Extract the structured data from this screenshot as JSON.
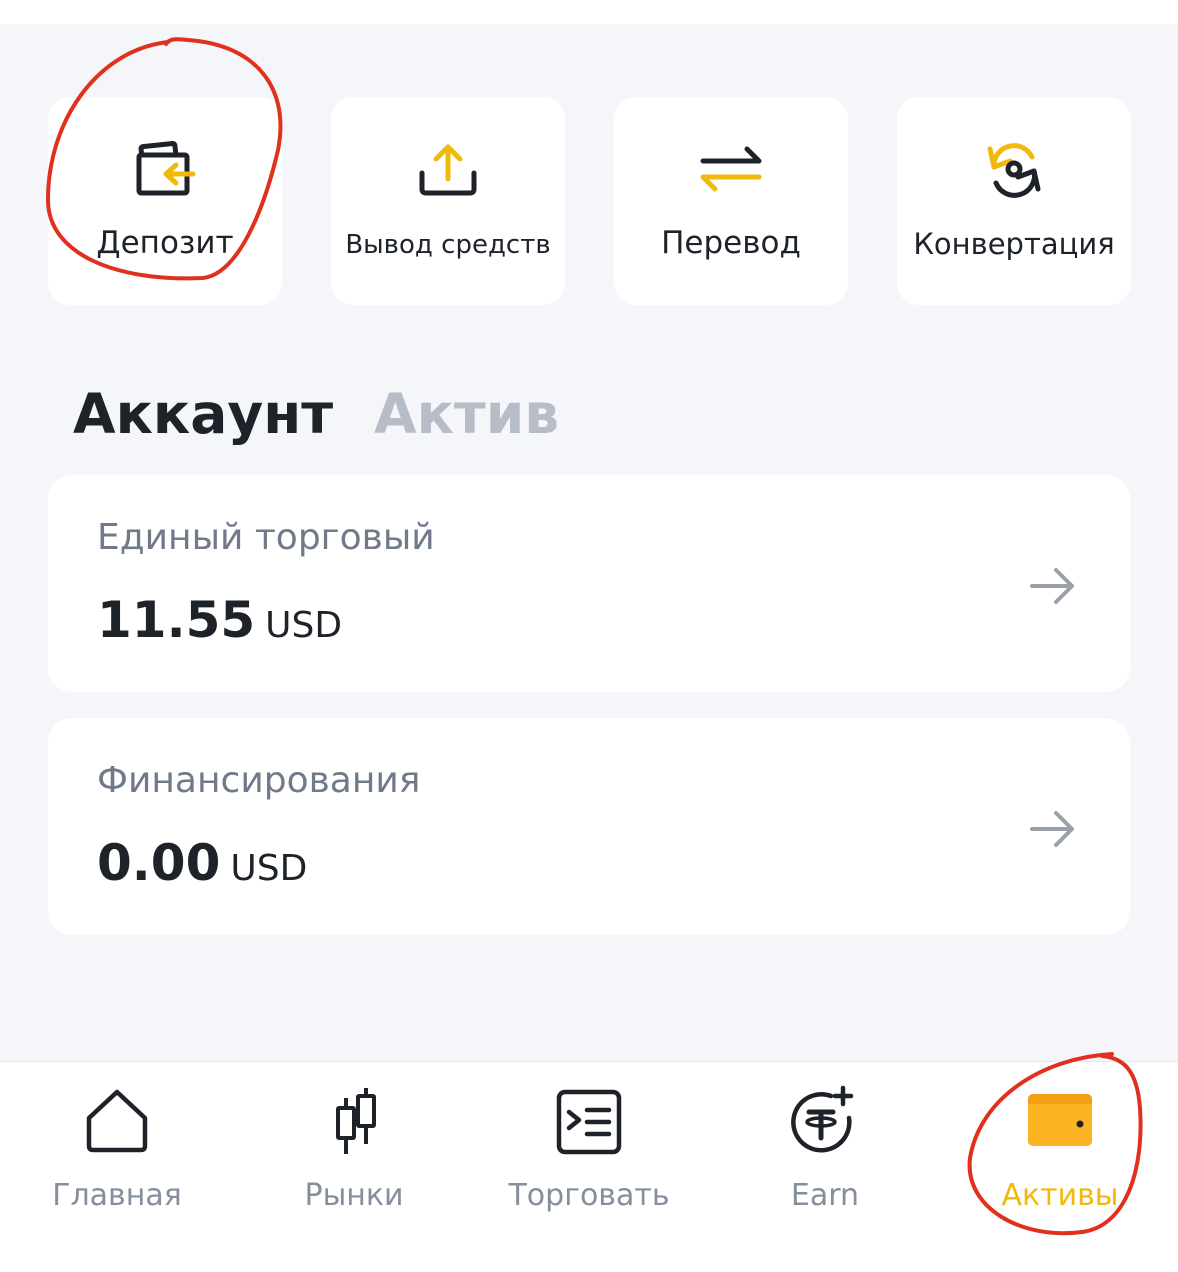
{
  "actions": [
    {
      "label": "Депозит",
      "icon": "deposit-icon"
    },
    {
      "label": "Вывод средств",
      "icon": "withdraw-icon"
    },
    {
      "label": "Перевод",
      "icon": "transfer-icon"
    },
    {
      "label": "Конвертация",
      "icon": "convert-icon"
    }
  ],
  "tabs": {
    "account": "Аккаунт",
    "asset": "Актив"
  },
  "accounts": [
    {
      "title": "Единый торговый",
      "amount": "11.55",
      "currency": "USD"
    },
    {
      "title": "Финансирования",
      "amount": "0.00",
      "currency": "USD"
    }
  ],
  "nav": [
    {
      "label": "Главная",
      "icon": "home-icon"
    },
    {
      "label": "Рынки",
      "icon": "candlestick-icon"
    },
    {
      "label": "Торговать",
      "icon": "trade-terminal-icon"
    },
    {
      "label": "Earn",
      "icon": "earn-icon"
    },
    {
      "label": "Активы",
      "icon": "wallet-icon",
      "active": true
    }
  ],
  "colors": {
    "accent": "#f0b90b",
    "text_primary": "#1e2329",
    "text_secondary": "#707a8a",
    "text_inactive": "#b7bdc6",
    "nav_inactive": "#848e9c",
    "background": "#f5f6fa",
    "card": "#ffffff",
    "annotation": "#e0301e"
  }
}
